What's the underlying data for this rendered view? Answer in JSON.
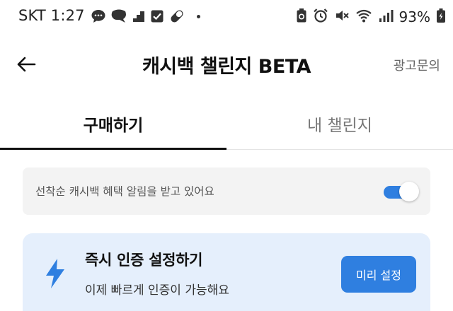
{
  "status_bar": {
    "carrier_time": "SKT 1:27",
    "battery": "93%",
    "icons_left": [
      "chat-bubble-icon",
      "bubble-icon",
      "steps-icon",
      "checkbox-icon",
      "pill-icon",
      "dot-icon"
    ],
    "icons_right": [
      "recycle-battery-icon",
      "alarm-icon",
      "mute-icon",
      "wifi-icon",
      "signal-icon",
      "battery-icon"
    ]
  },
  "app_bar": {
    "title": "캐시백 챌린지 BETA",
    "ad_link": "광고문의",
    "back_icon": "back-arrow-icon"
  },
  "tabs": [
    {
      "label": "구매하기",
      "active": true
    },
    {
      "label": "내 챌린지",
      "active": false
    }
  ],
  "notify": {
    "text": "선착순 캐시백 혜택 알림을 받고 있어요",
    "toggle_on": true
  },
  "verify_card": {
    "title": "즉시 인증 설정하기",
    "description": "이제 빠르게 인증이 가능해요",
    "button_label": "미리 설정",
    "icon": "lightning-bolt-icon"
  },
  "colors": {
    "accent": "#2f7fe0",
    "card_blue": "#e5effc",
    "card_gray": "#f3f3f3"
  }
}
